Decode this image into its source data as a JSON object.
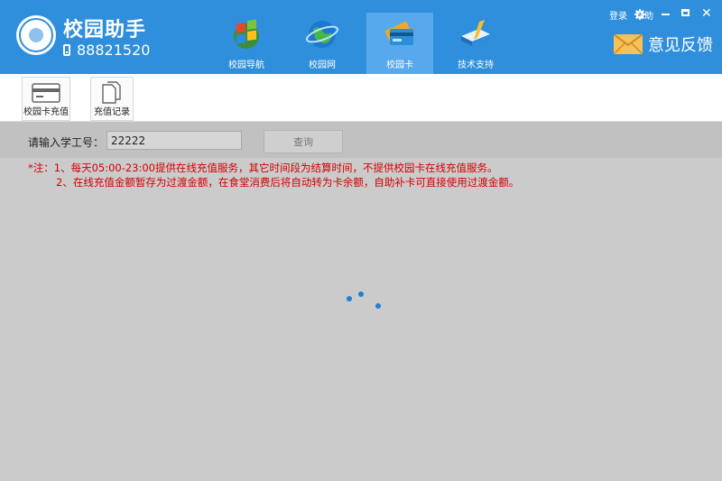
{
  "app": {
    "title": "校园助手",
    "hotline": "88821520"
  },
  "nav": {
    "tabs": [
      {
        "label": "校园导航",
        "icon": "windows-globe-icon",
        "active": false
      },
      {
        "label": "校园网",
        "icon": "globe-icon",
        "active": false
      },
      {
        "label": "校园卡",
        "icon": "card-icon",
        "active": true
      },
      {
        "label": "技术支持",
        "icon": "book-icon",
        "active": false
      }
    ]
  },
  "top_links": {
    "login": "登录",
    "help": "帮助"
  },
  "feedback": {
    "label": "意见反馈",
    "icon": "envelope-icon"
  },
  "toolbar": {
    "card_recharge": "校园卡充值",
    "recharge_records": "充值记录"
  },
  "query": {
    "label": "请输入学工号：",
    "value": "22222",
    "button": "查询"
  },
  "notes": {
    "line1": "*注：1、每天05:00-23:00提供在线充值服务，其它时间段为结算时间，不提供校园卡在线充值服务。",
    "line2": "2、在线充值金额暂存为过渡金额，在食堂消费后将自动转为卡余额，自助补卡可直接使用过渡金额。"
  },
  "colors": {
    "header": "#2f8fdc",
    "active_tab": "#57a9ec",
    "note_text": "#d20000",
    "spinner": "#1e7fd4",
    "content_bg": "#cbcbcb"
  }
}
